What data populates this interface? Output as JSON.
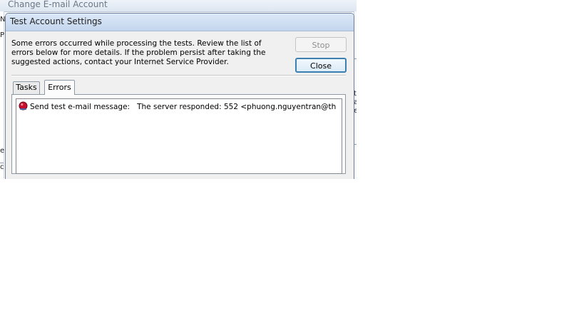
{
  "background_window": {
    "title": "Change E-mail Account",
    "fragments": [
      "N",
      "P",
      "e",
      "c",
      "t",
      "a",
      "e"
    ]
  },
  "dialog": {
    "title": "Test Account Settings",
    "message": "Some errors occurred while processing the tests. Review the list of errors below for more details. If the problem persist after taking the suggested actions, contact your Internet Service Provider.",
    "stop_label": "Stop",
    "close_label": "Close",
    "tabs": [
      {
        "label": "Tasks",
        "selected": false
      },
      {
        "label": "Errors",
        "selected": true
      }
    ],
    "errors": [
      {
        "icon": "error-icon",
        "task": "Send test e-mail message:",
        "detail": "The server responded: 552 <phuong.nguyentran@th"
      }
    ]
  },
  "colors": {
    "error_red": "#c8102e",
    "default_button_border": "#3c7fb1"
  }
}
